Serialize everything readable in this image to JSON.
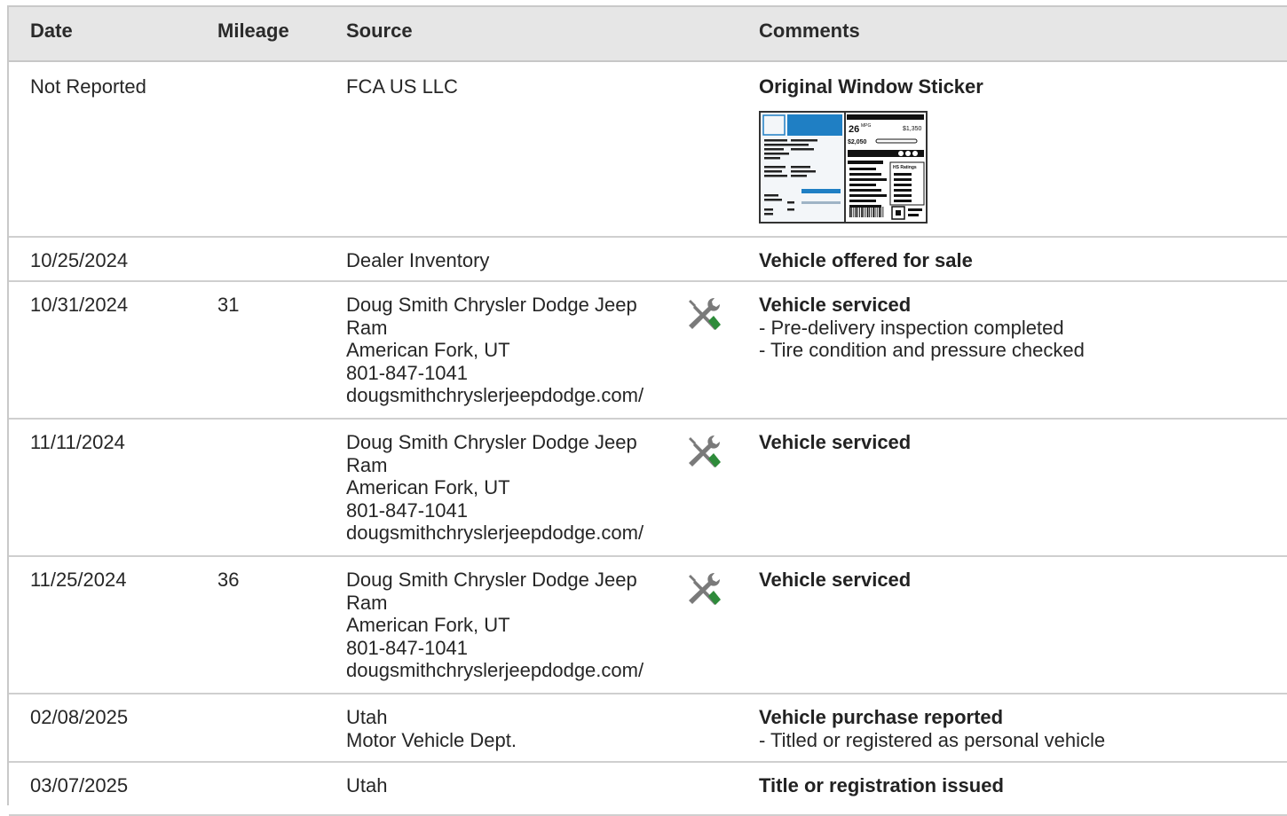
{
  "headers": {
    "date": "Date",
    "mileage": "Mileage",
    "source": "Source",
    "comments": "Comments"
  },
  "rows": [
    {
      "date": "Not Reported",
      "mileage": "",
      "source": [
        "FCA US LLC"
      ],
      "title": "Original Window Sticker",
      "notes": [],
      "icon": "",
      "sticker": {
        "mpg": "26",
        "mpg_unit": "MPG",
        "save": "$1,350",
        "cost": "$2,050",
        "ratings": "HS Ratings"
      }
    },
    {
      "date": "10/25/2024",
      "mileage": "",
      "source": [
        "Dealer Inventory"
      ],
      "title": "Vehicle offered for sale",
      "notes": [],
      "icon": ""
    },
    {
      "date": "10/31/2024",
      "mileage": "31",
      "source": [
        "Doug Smith Chrysler Dodge Jeep",
        "Ram",
        "American Fork, UT",
        "801-847-1041",
        "dougsmithchryslerjeepdodge.com/"
      ],
      "title": "Vehicle serviced",
      "notes": [
        "- Pre-delivery inspection completed",
        "- Tire condition and pressure checked"
      ],
      "icon": "wrench-screwdriver-icon"
    },
    {
      "date": "11/11/2024",
      "mileage": "",
      "source": [
        "Doug Smith Chrysler Dodge Jeep",
        "Ram",
        "American Fork, UT",
        "801-847-1041",
        "dougsmithchryslerjeepdodge.com/"
      ],
      "title": "Vehicle serviced",
      "notes": [],
      "icon": "wrench-screwdriver-icon"
    },
    {
      "date": "11/25/2024",
      "mileage": "36",
      "source": [
        "Doug Smith Chrysler Dodge Jeep",
        "Ram",
        "American Fork, UT",
        "801-847-1041",
        "dougsmithchryslerjeepdodge.com/"
      ],
      "title": "Vehicle serviced",
      "notes": [],
      "icon": "wrench-screwdriver-icon"
    },
    {
      "date": "02/08/2025",
      "mileage": "",
      "source": [
        "Utah",
        "Motor Vehicle Dept."
      ],
      "title": "Vehicle purchase reported",
      "notes": [
        "- Titled or registered as personal vehicle"
      ],
      "icon": ""
    },
    {
      "date": "03/07/2025",
      "mileage": "",
      "source": [
        "Utah"
      ],
      "title": "Title or registration issued",
      "notes": [],
      "icon": ""
    }
  ],
  "colors": {
    "header_bg": "#e6e6e6",
    "border": "#cfcfcf",
    "icon_gray": "#7a7a7a",
    "icon_green": "#2e8b3a",
    "sticker_blue": "#1f7fc4"
  }
}
